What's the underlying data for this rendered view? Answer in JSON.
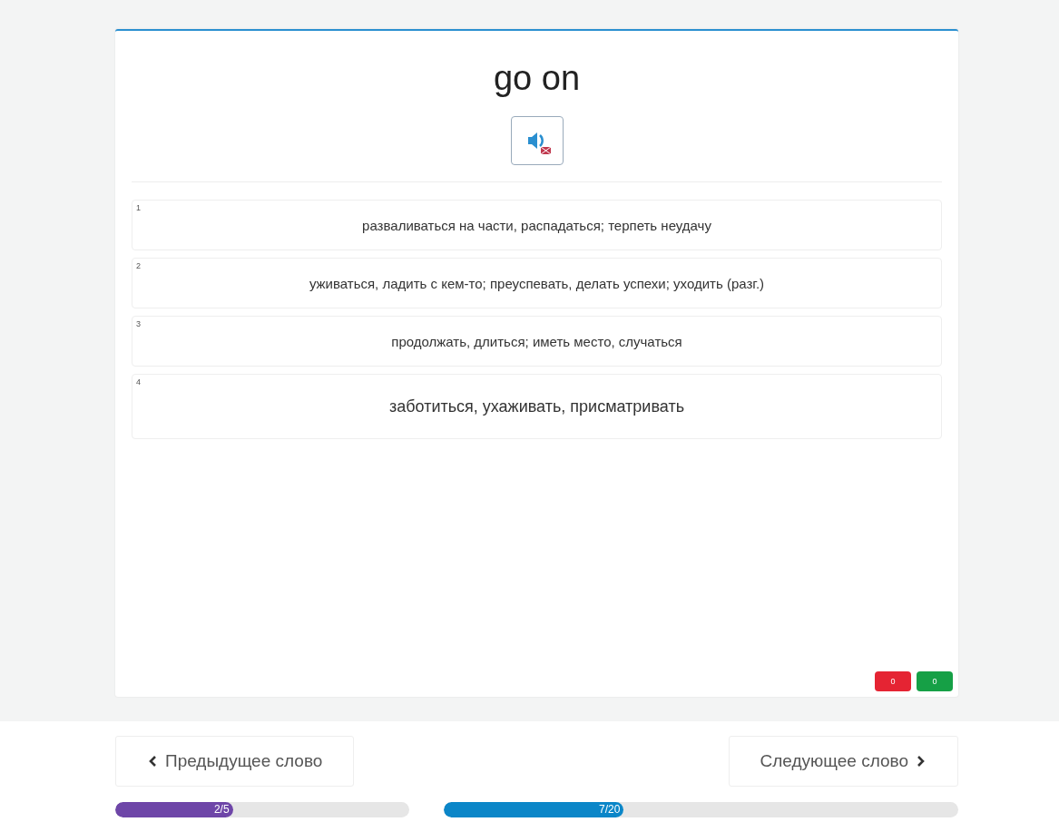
{
  "word": "go on",
  "options": [
    {
      "number": "1",
      "text": "разваливаться на части, распадаться; терпеть неудачу",
      "large": false
    },
    {
      "number": "2",
      "text": "уживаться, ладить с кем-то; преуспевать, делать успехи; уходить (разг.)",
      "large": false
    },
    {
      "number": "3",
      "text": "продолжать, длиться; иметь место, случаться",
      "large": false
    },
    {
      "number": "4",
      "text": "заботиться, ухаживать, присматривать",
      "large": true
    }
  ],
  "counters": [
    {
      "kind": "wrong",
      "value": "0"
    },
    {
      "kind": "right",
      "value": "0"
    }
  ],
  "prev_button": "Предыдущее слово",
  "next_button": "Следующее слово",
  "progress": [
    {
      "kind": "round",
      "label": "2/5",
      "level": 0.4
    },
    {
      "kind": "total",
      "label": "7/20",
      "level": 0.35
    }
  ]
}
